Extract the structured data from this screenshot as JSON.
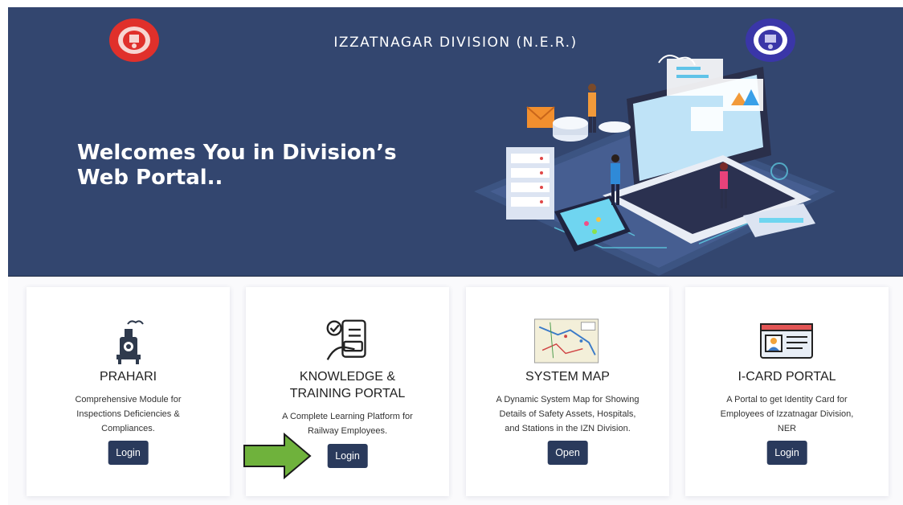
{
  "header": {
    "title": "IZZATNAGAR DIVISION (N.E.R.)",
    "welcome_line1": "Welcomes You in Division’s",
    "welcome_line2": "Web Portal.."
  },
  "cards": [
    {
      "title_line1": "PRAHARI",
      "title_line2": "",
      "desc_lines": [
        "Comprehensive Module for",
        "Inspections Deficiencies &",
        "Compliances."
      ],
      "button": "Login",
      "icon": "train-engine-icon"
    },
    {
      "title_line1": "KNOWLEDGE &",
      "title_line2": "TRAINING PORTAL",
      "desc_lines": [
        "A Complete Learning Platform for",
        "Railway Employees."
      ],
      "button": "Login",
      "icon": "mobile-checklist-icon"
    },
    {
      "title_line1": "SYSTEM MAP",
      "title_line2": "",
      "desc_lines": [
        "A Dynamic System Map for Showing",
        "Details of Safety Assets, Hospitals,",
        "and Stations in the IZN Division."
      ],
      "button": "Open",
      "icon": "map-icon"
    },
    {
      "title_line1": "I-CARD PORTAL",
      "title_line2": "",
      "desc_lines": [
        "A Portal to get Identity Card for",
        "Employees of Izzatnagar Division,",
        "NER"
      ],
      "button": "Login",
      "icon": "id-card-icon"
    }
  ],
  "colors": {
    "hero_bg": "#33466f",
    "button_bg": "#2a3a5c",
    "arrow": "#6fb23c"
  }
}
